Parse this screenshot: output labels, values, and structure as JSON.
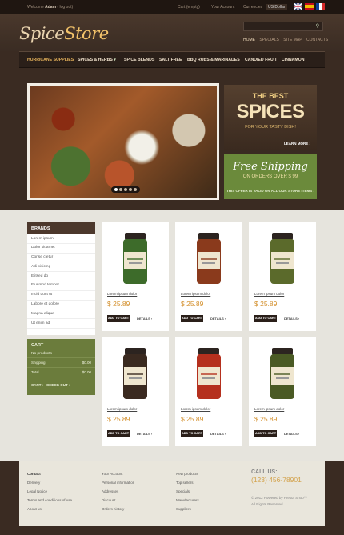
{
  "topbar": {
    "welcome_prefix": "Welcome",
    "user": "Adam",
    "logout": "( log out)",
    "cart": "Cart  (empty)",
    "account": "Your Account",
    "currencies": "Currencies",
    "currency": "US Dollar"
  },
  "header": {
    "logo_part1": "Spice",
    "logo_part2": "Store",
    "nav": [
      "HOME",
      "SPECIALS",
      "SITE MAP",
      "CONTACTS"
    ]
  },
  "menu": [
    {
      "label": "Hurricane supplies"
    },
    {
      "label": "Spices & Herbs",
      "dropdown": "▾"
    },
    {
      "label": "Spice Blends"
    },
    {
      "label": "Salt Free"
    },
    {
      "label": "BBQ Rubs & Marinades"
    },
    {
      "label": "Candied Fruit"
    },
    {
      "label": "Cinnamon"
    }
  ],
  "promo1": {
    "line1": "THE BEST",
    "line2": "SPICES",
    "line3": "FOR YOUR TASTY DISH!",
    "link": "LEARN MORE ›"
  },
  "promo2": {
    "line1": "Free Shipping",
    "line2": "ON ORDERS OVER $ 99",
    "line3": "THIS OFFER IS VALID ON ALL OUR STORE ITEMS ›"
  },
  "brands": {
    "title": "Brands",
    "items": [
      "Lorem ipsum",
      "Dolor sit amet",
      "Conse ctetur",
      "Adi pisicing",
      "Elitsed do",
      "Eiusmod tempor",
      "Incid dunt ut",
      "Labore et dolore",
      "Magna aliqua",
      "Ut enim ad"
    ]
  },
  "cart": {
    "title": "Cart",
    "empty": "No products",
    "shipping_label": "Shipping",
    "shipping_value": "$0.00",
    "total_label": "Total",
    "total_value": "$0.00",
    "cart_btn": "CART ›",
    "checkout_btn": "CHECK OUT ›"
  },
  "products": [
    {
      "name": "Lorem ipsum dolor",
      "price": "$ 25.89",
      "add": "ADD TO CART",
      "details": "DETAILS ›",
      "color": "#3d6b2a"
    },
    {
      "name": "Lorem ipsum dolor",
      "price": "$ 25.89",
      "add": "ADD TO CART",
      "details": "DETAILS ›",
      "color": "#8a3a1c"
    },
    {
      "name": "Lorem ipsum dolor",
      "price": "$ 25.89",
      "add": "ADD TO CART",
      "details": "DETAILS ›",
      "color": "#5b6a2b"
    },
    {
      "name": "Lorem ipsum dolor",
      "price": "$ 25.89",
      "add": "ADD TO CART",
      "details": "DETAILS ›",
      "color": "#3a2a20"
    },
    {
      "name": "Lorem ipsum dolor",
      "price": "$ 25.89",
      "add": "ADD TO CART",
      "details": "DETAILS ›",
      "color": "#b5301e"
    },
    {
      "name": "Lorem ipsum dolor",
      "price": "$ 25.89",
      "add": "ADD TO CART",
      "details": "DETAILS ›",
      "color": "#4a5a24"
    }
  ],
  "footer": {
    "col1": [
      "Contact",
      "Delivery",
      "Legal Notice",
      "Terms and conditions of use",
      "About us"
    ],
    "col2": [
      "Your Account",
      "Personal information",
      "Addresses",
      "Discount",
      "Orders history"
    ],
    "col3": [
      "New products",
      "Top sellers",
      "Specials",
      "Manufacturers",
      "Suppliers"
    ],
    "call_label": "CALL US:",
    "phone": "(123) 456-78901",
    "copyright": "© 2012 Powered by Presta Shop™",
    "rights": "All Rights Reserved"
  },
  "colors": {
    "accent": "#d4912f",
    "olive": "#6b8a3b",
    "dark": "#2a1f19"
  }
}
